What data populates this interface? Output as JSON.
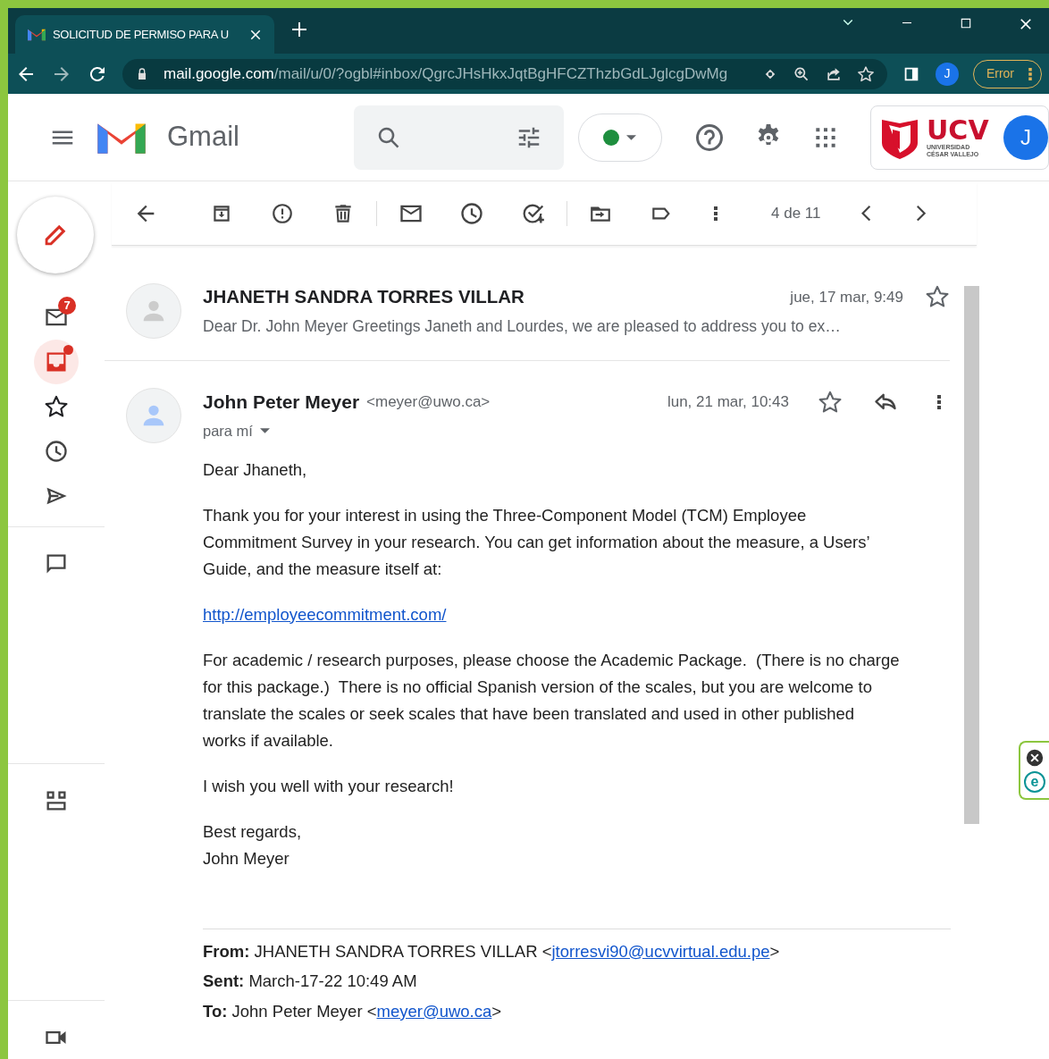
{
  "browser": {
    "tab_title": "SOLICITUD DE PERMISO PARA U",
    "url_host": "mail.google.com",
    "url_path": "/mail/u/0/?ogbl#inbox/QgrcJHsHkxJqtBgHFCZThzbGdLJglcgDwMg",
    "profile_initial": "J",
    "error_label": "Error"
  },
  "header": {
    "app_name": "Gmail",
    "org": {
      "name": "UCV",
      "line1": "UNIVERSIDAD",
      "line2": "CÉSAR VALLEJO"
    },
    "avatar": "J"
  },
  "rail": {
    "sections": [
      [
        {
          "selected": false,
          "badge": "7",
          "dot": false
        },
        {
          "selected": true,
          "dot": true
        },
        {
          "selected": false,
          "dot": false
        },
        {
          "selected": false,
          "dot": false
        },
        {
          "selected": false,
          "dot": false
        }
      ],
      [
        {
          "selected": false,
          "dot": false
        }
      ],
      [
        {
          "selected": false,
          "dot": false
        }
      ],
      [
        {
          "selected": false,
          "dot": false
        }
      ]
    ]
  },
  "toolbar": {
    "counter": "4 de 11"
  },
  "messages": [
    {
      "expanded": false,
      "starred": false,
      "sender": "JHANETH SANDRA TORRES VILLAR",
      "date": "jue, 17 mar, 9:49",
      "preview": "Dear Dr. John Meyer Greetings Janeth and Lourdes, we are pleased to address you to ex…"
    },
    {
      "expanded": true,
      "starred": false,
      "sender": "John Peter Meyer",
      "email": "<meyer@uwo.ca>",
      "date": "lun, 21 mar, 10:43",
      "recipient": "para mí",
      "body": [
        {
          "kind": "text",
          "lines": [
            "Dear Jhaneth,"
          ]
        },
        {
          "kind": "text",
          "lines": [
            "Thank you for your interest in using the Three-Component Model (TCM) Employee",
            "Commitment Survey in your research. You can get information about the measure, a Users’",
            "Guide, and the measure itself at:"
          ]
        },
        {
          "kind": "link",
          "lines": [
            "http://employeecommitment.com/"
          ]
        },
        {
          "kind": "text",
          "lines": [
            "For academic / research purposes, please choose the Academic Package.  (There is no charge",
            "for this package.)  There is no official Spanish version of the scales, but you are welcome to",
            "translate the scales or seek scales that have been translated and used in other published",
            "works if available."
          ]
        },
        {
          "kind": "text",
          "lines": [
            "I wish you well with your research!"
          ]
        },
        {
          "kind": "text",
          "lines": [
            "Best regards,",
            "John Meyer"
          ]
        }
      ],
      "quoted": [
        {
          "label": "From:",
          "text": "JHANETH SANDRA TORRES VILLAR <",
          "link": "jtorresvi90@ucvvirtual.edu.pe",
          "tail": ">"
        },
        {
          "label": "Sent:",
          "text": "March-17-22 10:49 AM"
        },
        {
          "label": "To:",
          "text": "John Peter Meyer <",
          "link": "meyer@uwo.ca",
          "tail": ">"
        }
      ]
    }
  ],
  "extension": {
    "letter": "e"
  }
}
